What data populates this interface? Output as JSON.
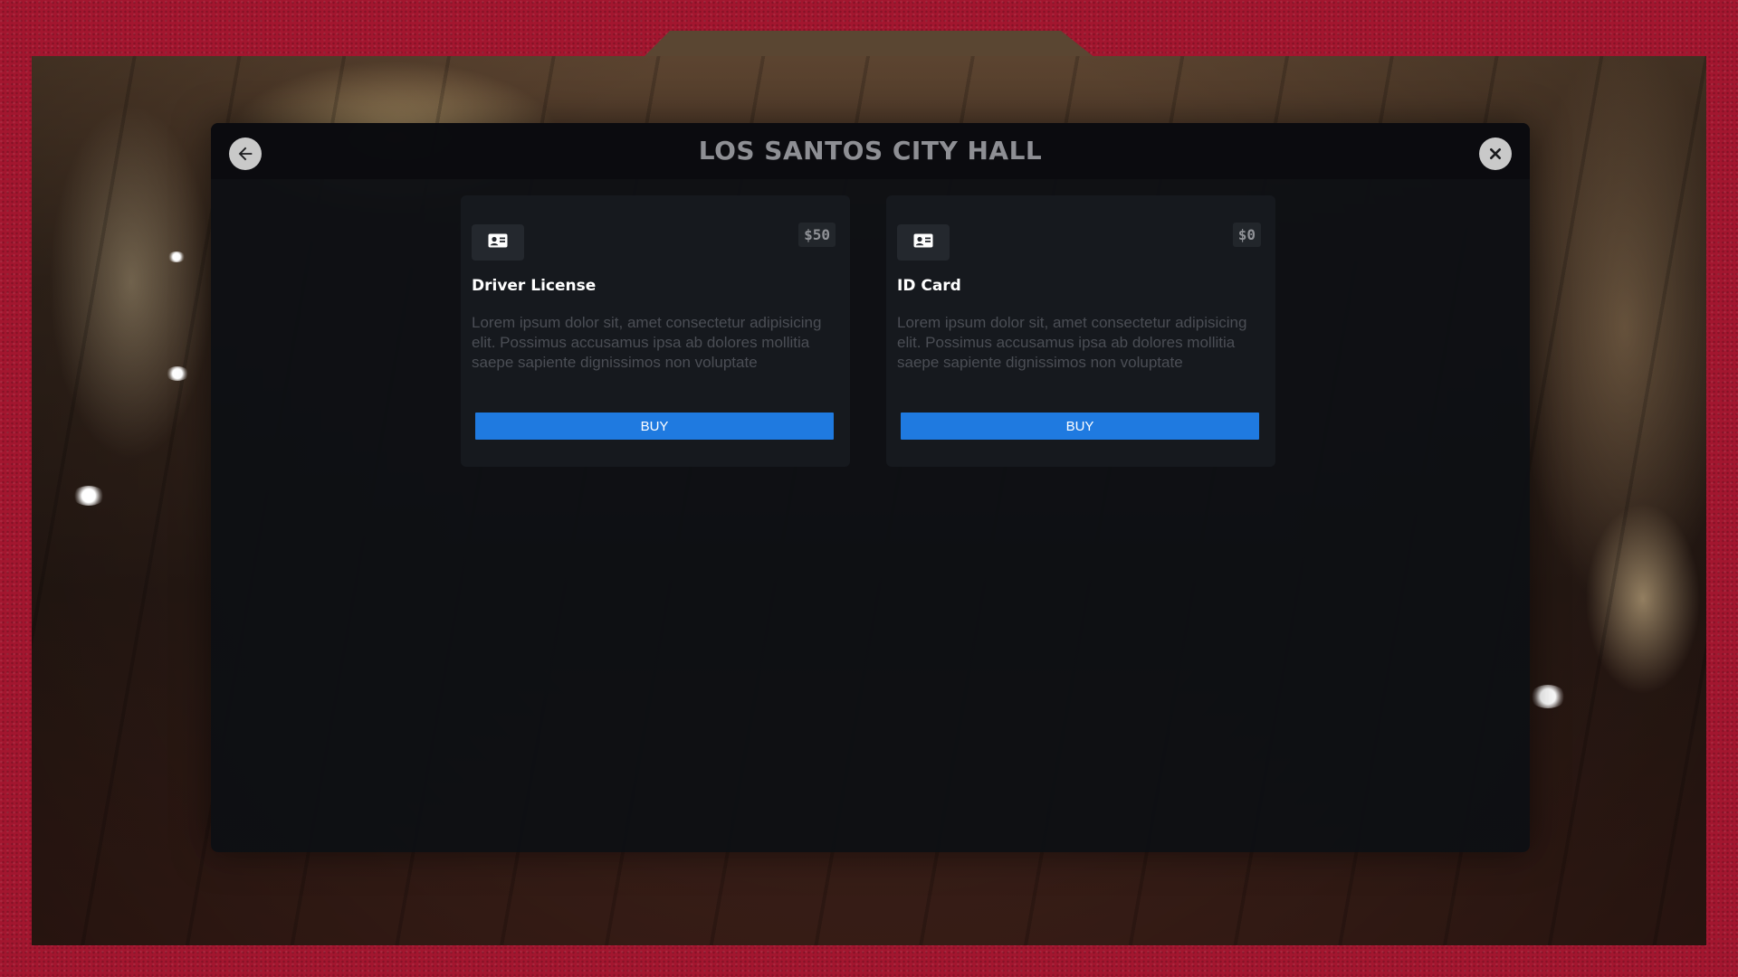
{
  "header": {
    "title": "LOS SANTOS CITY HALL",
    "back_icon": "arrow-left-icon",
    "close_icon": "close-icon"
  },
  "cards": [
    {
      "icon": "id-card-icon",
      "price": "$50",
      "name": "Driver License",
      "description": "Lorem ipsum dolor sit, amet consectetur adipisicing elit. Possimus accusamus ipsa ab dolores mollitia saepe sapiente dignissimos non voluptate",
      "button_label": "BUY"
    },
    {
      "icon": "id-card-icon",
      "price": "$0",
      "name": "ID Card",
      "description": "Lorem ipsum dolor sit, amet consectetur adipisicing elit. Possimus accusamus ipsa ab dolores mollitia saepe sapiente dignissimos non voluptate",
      "button_label": "BUY"
    }
  ],
  "colors": {
    "frame": "#a3162f",
    "panel": "#0e1014",
    "card": "#16191e",
    "button": "#1f7ae0",
    "title": "#8e8f94"
  }
}
